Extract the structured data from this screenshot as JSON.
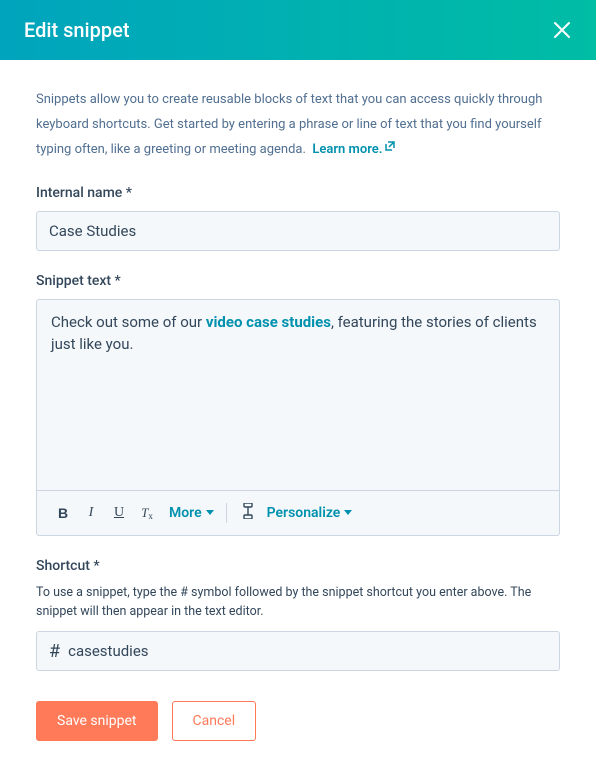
{
  "header": {
    "title": "Edit snippet"
  },
  "description": {
    "text": "Snippets allow you to create reusable blocks of text that you can access quickly through keyboard shortcuts. Get started by entering a phrase or line of text that you find yourself typing often, like a greeting or meeting agenda.",
    "learn_more": "Learn more."
  },
  "fields": {
    "internal_name": {
      "label": "Internal name *",
      "value": "Case Studies"
    },
    "snippet_text": {
      "label": "Snippet text *",
      "content_before": "Check out some of our ",
      "content_link": "video case studies",
      "content_after": ", featuring the stories of clients just like you."
    },
    "shortcut": {
      "label": "Shortcut *",
      "help": "To use a snippet, type the # symbol followed by the snippet shortcut you enter above. The snippet will then appear in the text editor.",
      "prefix": "#",
      "value": "casestudies"
    }
  },
  "toolbar": {
    "bold": "B",
    "italic": "I",
    "underline": "U",
    "more": "More",
    "personalize": "Personalize"
  },
  "buttons": {
    "save": "Save snippet",
    "cancel": "Cancel"
  }
}
